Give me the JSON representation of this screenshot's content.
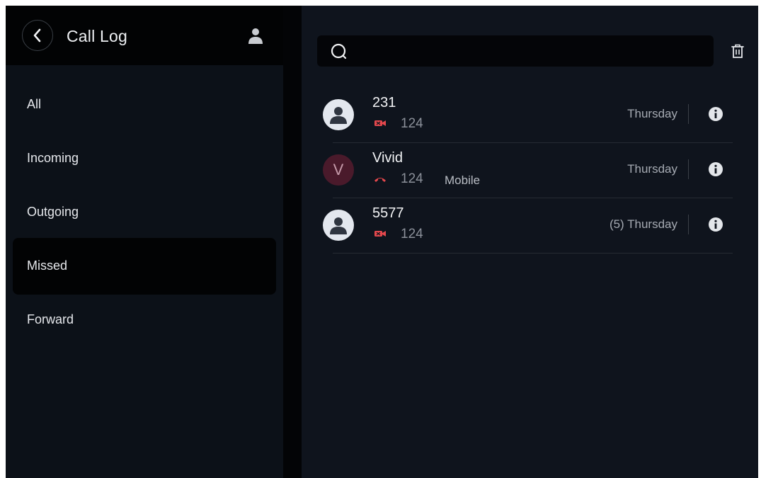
{
  "header": {
    "title": "Call Log"
  },
  "filters": [
    {
      "label": "All",
      "selected": false
    },
    {
      "label": "Incoming",
      "selected": false
    },
    {
      "label": "Outgoing",
      "selected": false
    },
    {
      "label": "Missed",
      "selected": true
    },
    {
      "label": "Forward",
      "selected": false
    }
  ],
  "search": {
    "value": "",
    "placeholder": ""
  },
  "calls": [
    {
      "name": "231",
      "avatar": "person-icon",
      "type": "missed-video-call-icon",
      "number": "124",
      "number_label": "",
      "time": "Thursday"
    },
    {
      "name": "Vivid",
      "avatar_letter": "V",
      "type": "missed-call-icon",
      "number": "124",
      "number_label": "Mobile",
      "time": "Thursday"
    },
    {
      "name": "5577",
      "avatar": "person-icon",
      "type": "missed-video-call-icon",
      "number": "124",
      "number_label": "",
      "time": "(5) Thursday"
    }
  ],
  "colors": {
    "missed": "#e5484d",
    "background": "#0f141d",
    "sidebar": "#0c1118"
  },
  "icons": [
    "back-icon",
    "contacts-icon",
    "search-icon",
    "delete-icon",
    "info-icon"
  ]
}
